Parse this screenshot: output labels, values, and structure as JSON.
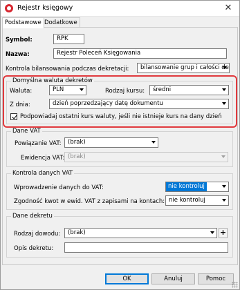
{
  "window": {
    "title": "Rejestr księgowy",
    "close_glyph": "✕"
  },
  "tabs": [
    {
      "label": "Podstawowe",
      "active": true
    },
    {
      "label": "Dodatkowe",
      "active": false
    }
  ],
  "form": {
    "symbol_label": "Symbol:",
    "symbol_value": "RPK",
    "nazwa_label": "Nazwa:",
    "nazwa_value": "Rejestr Poleceń Księgowania",
    "kontrola_label": "Kontrola bilansowania podczas dekretacji:",
    "kontrola_value": "bilansowanie grup i całości dekretu"
  },
  "currency_group": {
    "title": "Domyślna waluta dekretów",
    "waluta_label": "Waluta:",
    "waluta_value": "PLN",
    "rodzaj_kursu_label": "Rodzaj kursu:",
    "rodzaj_kursu_value": "średni",
    "z_dnia_label": "Z dnia:",
    "z_dnia_value": "dzień poprzedzający datę dokumentu",
    "checkbox_label": "Podpowiadaj ostatni kurs waluty, jeśli nie istnieje kurs na dany dzień",
    "checkbox_checked": true
  },
  "vat_group": {
    "title": "Dane VAT",
    "powiazanie_label": "Powiązanie VAT:",
    "powiazanie_value": "(brak)",
    "ewidencja_label": "Ewidencja VAT:",
    "ewidencja_value": "(brak)"
  },
  "vat_control_group": {
    "title": "Kontrola danych VAT",
    "wprowadzenie_label": "Wprowadzenie danych do VAT:",
    "wprowadzenie_value": "nie kontroluj",
    "zgodnosc_label": "Zgodność kwot w ewid. VAT z zapisami na kontach:",
    "zgodnosc_value": "nie kontroluj"
  },
  "dekret_group": {
    "title": "Dane dekretu",
    "rodzaj_label": "Rodzaj dowodu:",
    "rodzaj_value": "(brak)",
    "plus_label": "+",
    "opis_label": "Opis dekretu:",
    "opis_value": ""
  },
  "buttons": {
    "ok": "OK",
    "cancel": "Anuluj",
    "help": "Pomoc"
  },
  "colors": {
    "highlight_border": "#e0393d",
    "selection_blue": "#0078d7"
  },
  "icons": {
    "app": "app-logo-icon",
    "close": "close-icon",
    "dropdown": "chevron-down-icon",
    "grip": "resize-grip-icon"
  }
}
